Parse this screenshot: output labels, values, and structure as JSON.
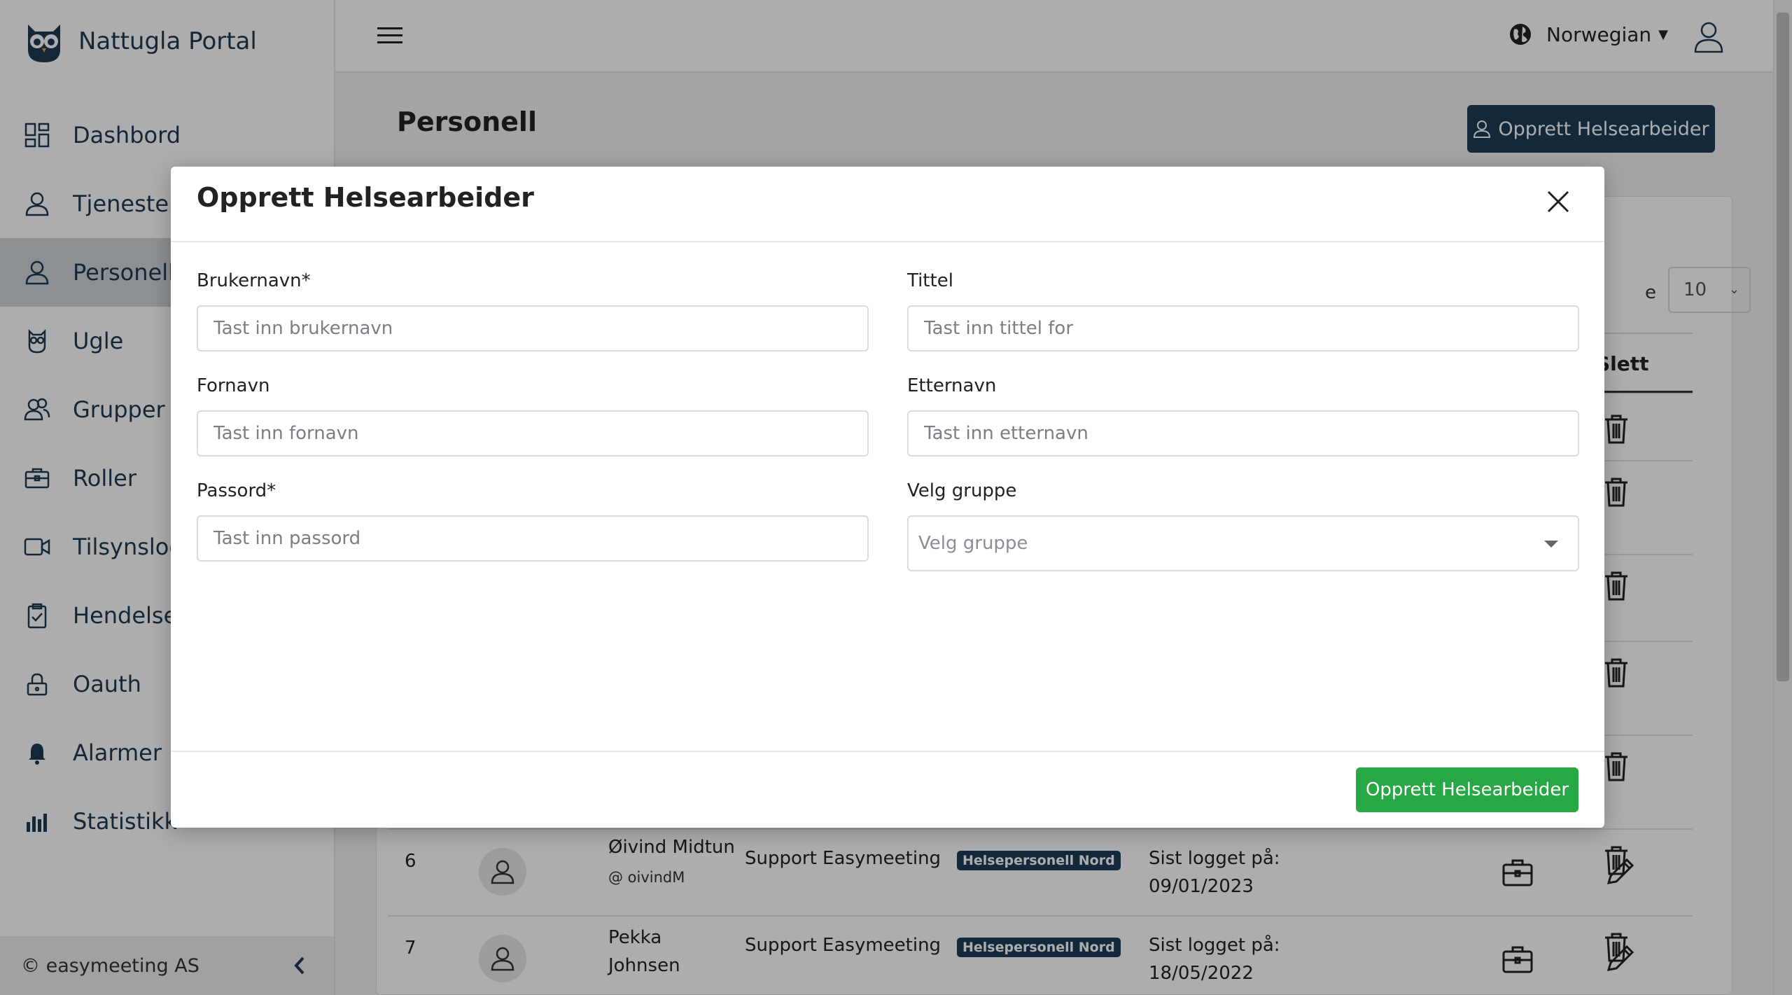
{
  "app": {
    "brand_name": "Nattugla Portal",
    "footer_text": "© easymeeting AS"
  },
  "sidebar": {
    "items": [
      {
        "label": "Dashbord",
        "icon": "dashboard-icon",
        "active": false
      },
      {
        "label": "Tjenestem",
        "icon": "user-icon",
        "active": false
      },
      {
        "label": "Personell",
        "icon": "user-icon",
        "active": true
      },
      {
        "label": "Ugle",
        "icon": "owl-icon",
        "active": false
      },
      {
        "label": "Grupper",
        "icon": "group-icon",
        "active": false
      },
      {
        "label": "Roller",
        "icon": "briefcase-icon",
        "active": false
      },
      {
        "label": "Tilsynslog",
        "icon": "video-icon",
        "active": false
      },
      {
        "label": "Hendelses",
        "icon": "clipboard-icon",
        "active": false
      },
      {
        "label": "Oauth",
        "icon": "key-icon",
        "active": false
      },
      {
        "label": "Alarmer",
        "icon": "bell-icon",
        "active": false
      },
      {
        "label": "Statistikk",
        "icon": "chart-icon",
        "active": false
      }
    ]
  },
  "topbar": {
    "language_label": "Norwegian"
  },
  "page": {
    "title": "Personell",
    "create_button": "Opprett Helsearbeider",
    "per_page_label": "e",
    "per_page_value": "10",
    "table_header_delete": "Slett"
  },
  "rows": [
    {
      "index": "6",
      "name": "Øivind Midtun",
      "handle": "@ oivindM",
      "org": "Support Easymeeting",
      "group": "Helsepersonell Nord",
      "last_login_label": "Sist logget på:",
      "last_login_date": "09/01/2023"
    },
    {
      "index": "7",
      "name": "Pekka Johnsen",
      "handle": "",
      "org": "Support Easymeeting",
      "group": "Helsepersonell Nord",
      "last_login_label": "Sist logget på:",
      "last_login_date": "18/05/2022"
    }
  ],
  "modal": {
    "title": "Opprett Helsearbeider",
    "fields": {
      "username": {
        "label": "Brukernavn*",
        "placeholder": "Tast inn brukernavn",
        "value": ""
      },
      "title": {
        "label": "Tittel",
        "placeholder": "Tast inn tittel for",
        "value": ""
      },
      "first_name": {
        "label": "Fornavn",
        "placeholder": "Tast inn fornavn",
        "value": ""
      },
      "last_name": {
        "label": "Etternavn",
        "placeholder": "Tast inn etternavn",
        "value": ""
      },
      "password": {
        "label": "Passord*",
        "placeholder": "Tast inn passord",
        "value": ""
      },
      "group": {
        "label": "Velg gruppe",
        "placeholder": "Velg gruppe"
      }
    },
    "submit_label": "Opprett Helsearbeider"
  },
  "colors": {
    "primary": "#1c3c56",
    "success": "#28a745",
    "sidebar_active": "#cfd4d9"
  }
}
